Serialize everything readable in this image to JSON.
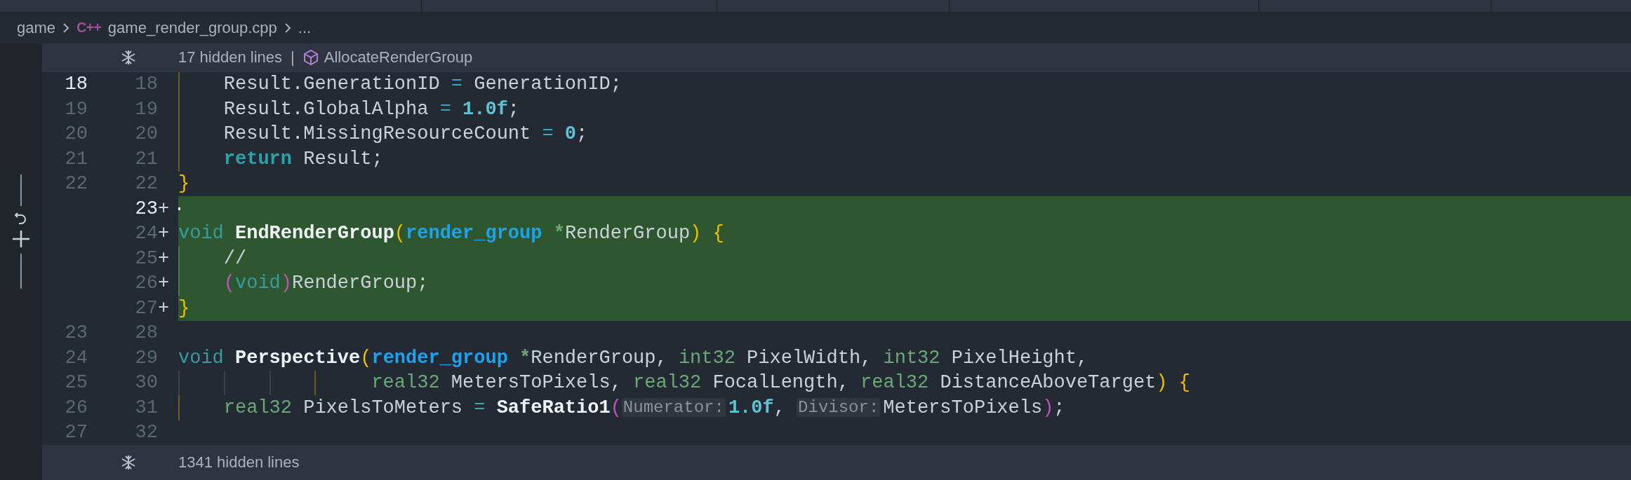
{
  "breadcrumb": {
    "folder": "game",
    "language_badge": "C++",
    "file": "game_render_group.cpp",
    "more": "..."
  },
  "top_fold": {
    "count_text": "17 hidden lines",
    "separator": "|",
    "symbol": "AllocateRenderGroup"
  },
  "rows": [
    {
      "old": "18",
      "new": "18",
      "old_active": true,
      "new_active": false,
      "added": false,
      "indented": true,
      "tokens": [
        {
          "text": "Result.GenerationID",
          "kind": "plain"
        },
        {
          "text": "=",
          "kind": "op",
          "space": true
        },
        {
          "text": "GenerationID;",
          "kind": "plain",
          "space": true
        }
      ]
    },
    {
      "old": "19",
      "new": "19",
      "old_active": false,
      "new_active": false,
      "added": false,
      "indented": true,
      "tokens": [
        {
          "text": "Result.GlobalAlpha",
          "kind": "plain"
        },
        {
          "text": "=",
          "kind": "op",
          "space": true
        },
        {
          "text": "1.0f",
          "kind": "number",
          "space": true
        },
        {
          "text": ";",
          "kind": "plain"
        }
      ]
    },
    {
      "old": "20",
      "new": "20",
      "old_active": false,
      "new_active": false,
      "added": false,
      "indented": true,
      "tokens": [
        {
          "text": "Result.MissingResourceCount",
          "kind": "plain"
        },
        {
          "text": "=",
          "kind": "op",
          "space": true
        },
        {
          "text": "0",
          "kind": "number",
          "space": true
        },
        {
          "text": ";",
          "kind": "plain"
        }
      ]
    },
    {
      "old": "21",
      "new": "21",
      "old_active": false,
      "new_active": false,
      "added": false,
      "indented": true,
      "tokens": [
        {
          "text": "return",
          "kind": "control"
        },
        {
          "text": "Result;",
          "kind": "plain",
          "space": true
        }
      ]
    },
    {
      "old": "22",
      "new": "22",
      "old_active": false,
      "new_active": false,
      "added": false,
      "tokens": [
        {
          "text": "}",
          "kind": "brace"
        }
      ]
    },
    {
      "new": "23",
      "marker": "+",
      "new_active": true,
      "added": true,
      "cursor": true,
      "tokens": []
    },
    {
      "new": "24",
      "marker": "+",
      "new_active": false,
      "added": true,
      "tokens": [
        {
          "text": "void",
          "kind": "keyword"
        },
        {
          "text": "EndRenderGroup",
          "kind": "function",
          "space": true
        },
        {
          "text": "(",
          "kind": "brace"
        },
        {
          "text": "render_group",
          "kind": "type"
        },
        {
          "text": "*",
          "kind": "pointer",
          "space": true
        },
        {
          "text": "RenderGroup",
          "kind": "plain"
        },
        {
          "text": ")",
          "kind": "brace"
        },
        {
          "text": "{",
          "kind": "brace",
          "space": true
        }
      ]
    },
    {
      "new": "25",
      "marker": "+",
      "new_active": false,
      "added": true,
      "indented": true,
      "tokens": [
        {
          "text": "//",
          "kind": "plain"
        }
      ]
    },
    {
      "new": "26",
      "marker": "+",
      "new_active": false,
      "added": true,
      "indented": true,
      "tokens": [
        {
          "text": "(",
          "kind": "paren2"
        },
        {
          "text": "void",
          "kind": "keyword"
        },
        {
          "text": ")",
          "kind": "paren2"
        },
        {
          "text": "RenderGroup;",
          "kind": "plain"
        }
      ]
    },
    {
      "new": "27",
      "marker": "+",
      "new_active": false,
      "added": true,
      "tokens": [
        {
          "text": "}",
          "kind": "brace"
        }
      ]
    },
    {
      "old": "23",
      "new": "28",
      "old_active": false,
      "new_active": false,
      "added": false,
      "tokens": []
    },
    {
      "old": "24",
      "new": "29",
      "old_active": false,
      "new_active": false,
      "added": false,
      "tokens": [
        {
          "text": "void",
          "kind": "keyword"
        },
        {
          "text": "Perspective",
          "kind": "function",
          "space": true
        },
        {
          "text": "(",
          "kind": "brace"
        },
        {
          "text": "render_group",
          "kind": "type"
        },
        {
          "text": "*",
          "kind": "pointer",
          "space": true
        },
        {
          "text": "RenderGroup,",
          "kind": "plain"
        },
        {
          "text": "int32",
          "kind": "type2",
          "space": true
        },
        {
          "text": "PixelWidth,",
          "kind": "plain",
          "space": true
        },
        {
          "text": "int32",
          "kind": "type2",
          "space": true
        },
        {
          "text": "PixelHeight,",
          "kind": "plain",
          "space": true
        }
      ]
    },
    {
      "old": "25",
      "new": "30",
      "old_active": false,
      "new_active": false,
      "added": false,
      "continuation": true,
      "tokens": [
        {
          "text": "real32",
          "kind": "type2"
        },
        {
          "text": "MetersToPixels,",
          "kind": "plain",
          "space": true
        },
        {
          "text": "real32",
          "kind": "type2",
          "space": true
        },
        {
          "text": "FocalLength,",
          "kind": "plain",
          "space": true
        },
        {
          "text": "real32",
          "kind": "type2",
          "space": true
        },
        {
          "text": "DistanceAboveTarget",
          "kind": "plain",
          "space": true
        },
        {
          "text": ")",
          "kind": "brace"
        },
        {
          "text": "{",
          "kind": "brace",
          "space": true
        }
      ]
    },
    {
      "old": "26",
      "new": "31",
      "old_active": false,
      "new_active": false,
      "added": false,
      "indented": true,
      "tokens": [
        {
          "text": "real32",
          "kind": "type2"
        },
        {
          "text": "PixelsToMeters",
          "kind": "plain",
          "space": true
        },
        {
          "text": "=",
          "kind": "op",
          "space": true
        },
        {
          "text": "SafeRatio1",
          "kind": "function",
          "space": true
        },
        {
          "text": "(",
          "kind": "paren2"
        },
        {
          "text": "Numerator:",
          "kind": "hint"
        },
        {
          "text": "1.0f",
          "kind": "number"
        },
        {
          "text": ",",
          "kind": "plain"
        },
        {
          "text": "Divisor:",
          "kind": "hint",
          "space": true
        },
        {
          "text": "MetersToPixels",
          "kind": "plain"
        },
        {
          "text": ")",
          "kind": "paren2"
        },
        {
          "text": ";",
          "kind": "plain"
        }
      ]
    },
    {
      "old": "27",
      "new": "32",
      "old_active": false,
      "new_active": false,
      "added": false,
      "tokens": []
    }
  ],
  "bottom_fold": {
    "count_text": "1341 hidden lines"
  }
}
